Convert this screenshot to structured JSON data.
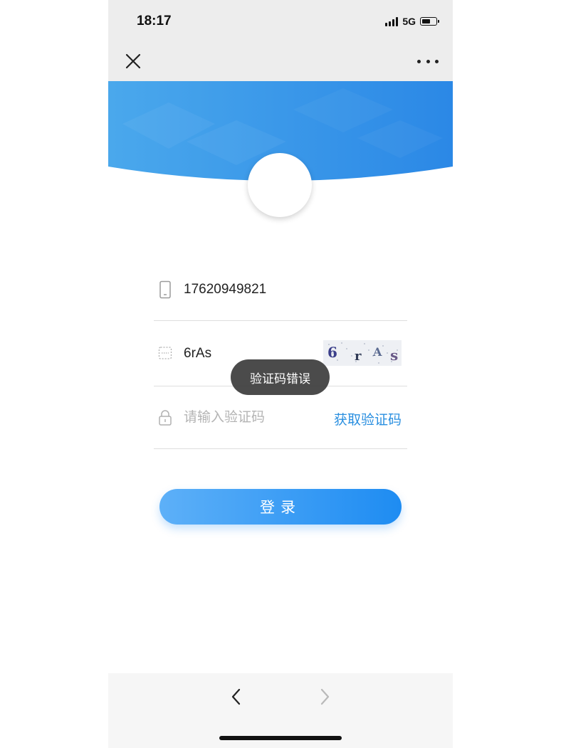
{
  "status_bar": {
    "time": "18:17",
    "network": "5G"
  },
  "nav": {
    "close_icon": "close-icon",
    "more_icon": "more-icon"
  },
  "form": {
    "phone": {
      "icon": "phone-icon",
      "value": "17620949821"
    },
    "captcha": {
      "icon": "captcha-icon",
      "value": "6rAs",
      "image_text": "6 r A s"
    },
    "sms": {
      "icon": "lock-icon",
      "placeholder": "请输入验证码",
      "get_code_label": "获取验证码"
    }
  },
  "toast": {
    "message": "验证码错误"
  },
  "login_button": {
    "label": "登录"
  },
  "bottom_nav": {
    "back_icon": "back-arrow-icon",
    "forward_icon": "forward-arrow-icon"
  },
  "colors": {
    "accent": "#1e8cf2",
    "link": "#2a8fe0",
    "banner_start": "#4aa8ec",
    "banner_end": "#2b88e6"
  }
}
